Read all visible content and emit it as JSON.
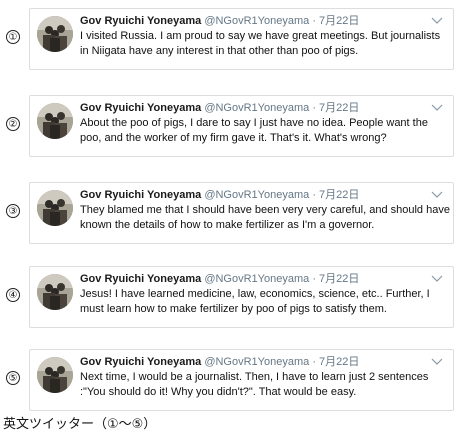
{
  "tweets": [
    {
      "number": "①",
      "display_name": "Gov Ryuichi Yoneyama",
      "handle": "@NGovR1Yoneyama",
      "separator": "·",
      "date": "7月22日",
      "text": "I visited Russia. I am proud to say we have great meetings.  But journalists in Niigata have any interest in that other than poo of pigs."
    },
    {
      "number": "②",
      "display_name": "Gov Ryuichi Yoneyama",
      "handle": "@NGovR1Yoneyama",
      "separator": "·",
      "date": "7月22日",
      "text": "About the poo of pigs, I dare to say I just have no idea.  People want the poo, and the worker of my firm gave it.  That's it. What's wrong?"
    },
    {
      "number": "③",
      "display_name": "Gov Ryuichi Yoneyama",
      "handle": "@NGovR1Yoneyama",
      "separator": "·",
      "date": "7月22日",
      "text": "They blamed me that I should have been very very careful, and should have known the details of how to make fertilizer as I'm a governor."
    },
    {
      "number": "④",
      "display_name": "Gov Ryuichi Yoneyama",
      "handle": "@NGovR1Yoneyama",
      "separator": "·",
      "date": "7月22日",
      "text": "Jesus! I have learned medicine, law, economics, science, etc.. Further, I must learn how to make fertilizer by poo of pigs to satisfy them."
    },
    {
      "number": "⑤",
      "display_name": "Gov Ryuichi Yoneyama",
      "handle": "@NGovR1Yoneyama",
      "separator": "·",
      "date": "7月22日",
      "text": "Next time, I would be a journalist. Then, I have to learn just 2 sentences :\"You should do it! Why you didn't?\". That would be easy."
    }
  ],
  "caption": "英文ツイッター（①〜⑤）",
  "icons": {
    "avatar": "avatar-photo",
    "menu": "chevron-down-icon"
  },
  "colors": {
    "card_border": "#dddddd",
    "meta_text": "#657786",
    "body_text": "#111111"
  }
}
